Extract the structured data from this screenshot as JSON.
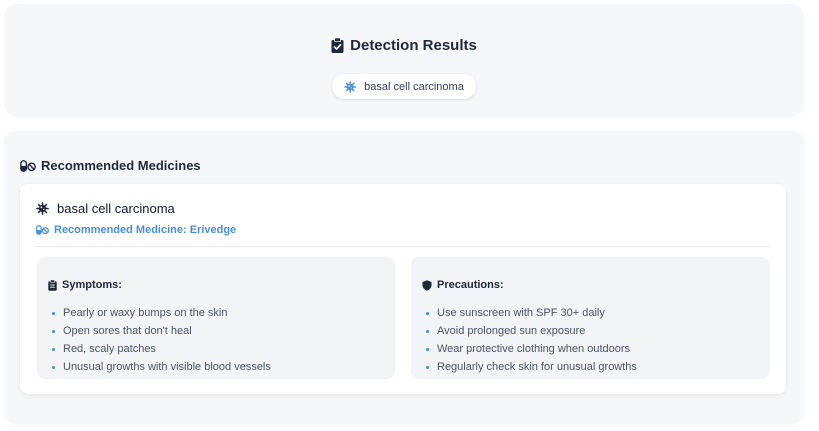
{
  "results": {
    "title": "Detection Results",
    "title_icon": "clipboard-check-icon",
    "chip_icon": "virus-icon",
    "detected": "basal cell carcinoma"
  },
  "medicines": {
    "title": "Recommended Medicines",
    "title_icon": "pills-icon",
    "card": {
      "disease": "basal cell carcinoma",
      "disease_icon": "virus-icon",
      "medicine": "Recommended Medicine: Erivedge",
      "medicine_icon": "pills-icon",
      "symptoms": {
        "title": "Symptoms:",
        "icon": "clipboard-icon",
        "items": [
          "Pearly or waxy bumps on the skin",
          "Open sores that don't heal",
          "Red, scaly patches",
          "Unusual growths with visible blood vessels"
        ]
      },
      "precautions": {
        "title": "Precautions:",
        "icon": "shield-icon",
        "items": [
          "Use sunscreen with SPF 30+ daily",
          "Avoid prolonged sun exposure",
          "Wear protective clothing when outdoors",
          "Regularly check skin for unusual growths"
        ]
      }
    }
  },
  "colors": {
    "accent": "#4a90d9",
    "text": "#1f2937",
    "panel": "#f6f7f9",
    "box": "#f3f4f6"
  }
}
